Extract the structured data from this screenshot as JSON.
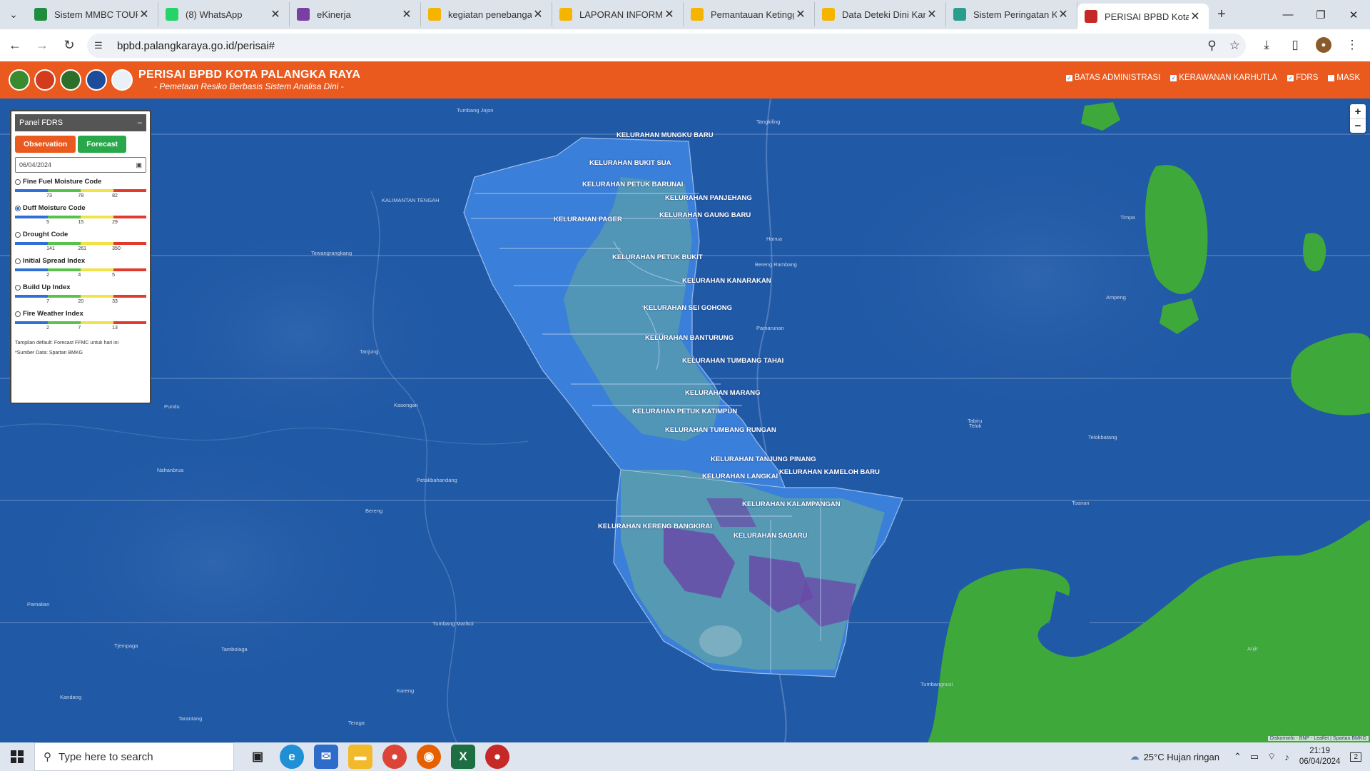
{
  "browser": {
    "tabs": [
      {
        "title": "Sistem MMBC TOUR",
        "icon": "sheets-icon",
        "color": "#1e8e3e"
      },
      {
        "title": "(8) WhatsApp",
        "icon": "whatsapp-icon",
        "color": "#25d366"
      },
      {
        "title": "eKinerja",
        "icon": "ekinerja-icon",
        "color": "#7b3fa0"
      },
      {
        "title": "kegiatan penebangan",
        "icon": "drive-icon",
        "color": "#f4b400"
      },
      {
        "title": "LAPORAN INFORMA",
        "icon": "drive-icon",
        "color": "#f4b400"
      },
      {
        "title": "Pemantauan Ketingg",
        "icon": "drive-icon",
        "color": "#f4b400"
      },
      {
        "title": "Data Deteki Dini Karh",
        "icon": "drive-icon",
        "color": "#f4b400"
      },
      {
        "title": "Sistem Peringatan Ke",
        "icon": "bmkg-icon",
        "color": "#2a9d8f"
      },
      {
        "title": "PERISAI BPBD Kota P",
        "icon": "perisai-icon",
        "color": "#c62828"
      }
    ],
    "url": "bpbd.palangkaraya.go.id/perisai#"
  },
  "app": {
    "title": "PERISAI BPBD KOTA PALANGKA RAYA",
    "subtitle": "- Pemetaan Resiko Berbasis Sistem Analisa Dini -",
    "layers": [
      "BATAS ADMINISTRASI",
      "KERAWANAN KARHUTLA",
      "FDRS",
      "MASK"
    ],
    "accent": "#ea5a1f"
  },
  "panel": {
    "title": "Panel FDRS",
    "collapse": "–",
    "observation": "Observation",
    "forecast": "Forecast",
    "date": "06/04/2024",
    "indices": [
      {
        "name": "Fine Fuel Moisture Code",
        "ticks": [
          "73",
          "78",
          "82"
        ],
        "selected": false
      },
      {
        "name": "Duff Moisture Code",
        "ticks": [
          "5",
          "15",
          "29"
        ],
        "selected": true
      },
      {
        "name": "Drought Code",
        "ticks": [
          "141",
          "261",
          "350"
        ],
        "selected": false
      },
      {
        "name": "Initial Spread Index",
        "ticks": [
          "2",
          "4",
          "5"
        ],
        "selected": false
      },
      {
        "name": "Build Up Index",
        "ticks": [
          "7",
          "20",
          "33"
        ],
        "selected": false
      },
      {
        "name": "Fire Weather Index",
        "ticks": [
          "2",
          "7",
          "13"
        ],
        "selected": false
      }
    ],
    "note1": "Tampilan default: Forecast FFMC untuk hari ini",
    "note2": "*Sumber Data: Spartan BMKG"
  },
  "map": {
    "kelurahan": [
      "KELURAHAN MUNGKU BARU",
      "KELURAHAN BUKIT SUA",
      "KELURAHAN PETUK BARUNAI",
      "KELURAHAN PANJEHANG",
      "KELURAHAN GAUNG BARU",
      "KELURAHAN PAGER",
      "KELURAHAN PETUK BUKIT",
      "KELURAHAN KANARAKAN",
      "KELURAHAN SEI GOHONG",
      "KELURAHAN BANTURUNG",
      "KELURAHAN TUMBANG TAHAI",
      "KELURAHAN MARANG",
      "KELURAHAN PETUK KATIMPUN",
      "KELURAHAN TUMBANG RUNGAN",
      "KELURAHAN TANJUNG PINANG",
      "KELURAHAN LANGKAI",
      "KELURAHAN KAMELOH BARU",
      "KELURAHAN KALAMPANGAN",
      "KELURAHAN KERENG BANGKIRAI",
      "KELURAHAN SABARU"
    ],
    "places": [
      "Tumbang Jojon",
      "Tangkiling",
      "KALIMANTAN TENGAH",
      "Tewangrangkang",
      "Hanua",
      "Timpa",
      "Ampeng",
      "Tabiru",
      "Bereng Rambang",
      "Pamarunan",
      "Kasongan",
      "Tanjung",
      "Pundu",
      "Telok",
      "Telokbatang",
      "Nahanbrua",
      "Petakbahandang",
      "Bereng",
      "Toanan",
      "Pamalian",
      "Tumbang Marikoi",
      "Tambolaga",
      "Tjempaga",
      "Kandang",
      "Kareng",
      "Tarantang",
      "Teraga",
      "Tumbangnusi",
      "Anjir"
    ],
    "zoom_in": "+",
    "zoom_out": "−",
    "attribution": "Diskominfo - BNP - Leaflet | Spartan BMKG"
  },
  "taskbar": {
    "search_placeholder": "Type here to search",
    "weather": "25°C  Hujan ringan",
    "time": "21:19",
    "date": "06/04/2024",
    "notifications": "2"
  }
}
